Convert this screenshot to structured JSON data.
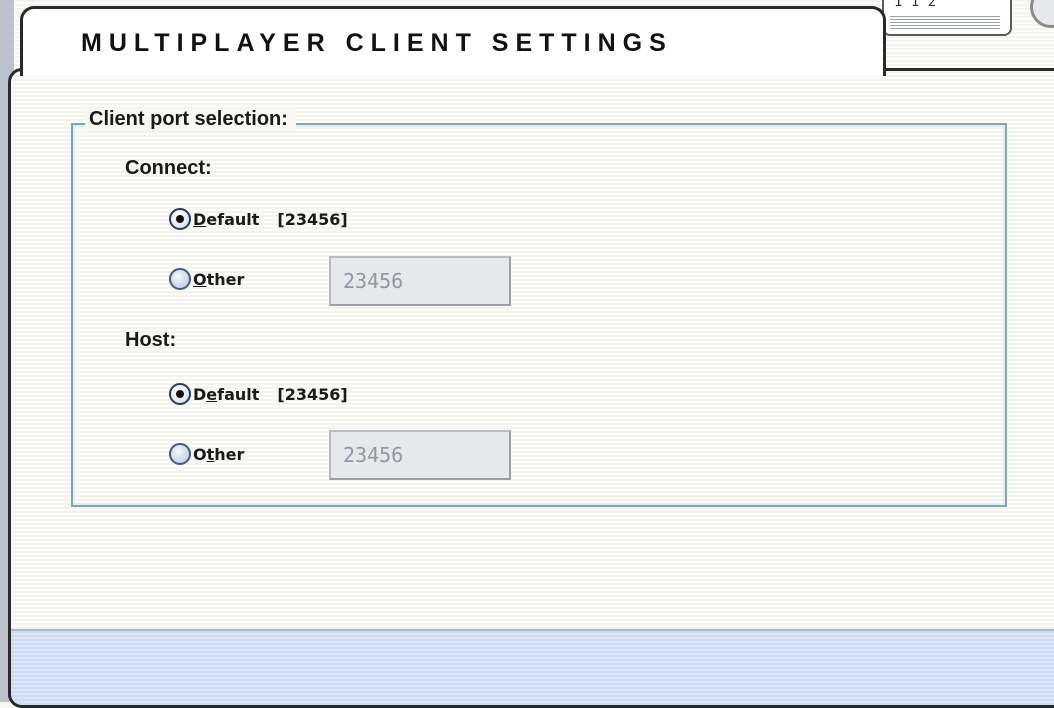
{
  "window": {
    "title": "MULTIPLAYER CLIENT SETTINGS",
    "corner_tab_fragment": "1 1 2"
  },
  "port_selection": {
    "legend": "Client port selection:",
    "connect": {
      "label": "Connect:",
      "default_option": {
        "label_pre": "",
        "label_mnemonic": "D",
        "label_post": "efault",
        "port_display": "[23456]",
        "checked": true
      },
      "other_option": {
        "label_pre": "",
        "label_mnemonic": "O",
        "label_post": "ther",
        "checked": false
      },
      "other_port_value": "23456"
    },
    "host": {
      "label": "Host:",
      "default_option": {
        "label_pre": "D",
        "label_mnemonic": "e",
        "label_post": "fault",
        "port_display": "[23456]",
        "checked": true
      },
      "other_option": {
        "label_pre": "O",
        "label_mnemonic": "t",
        "label_post": "her",
        "checked": false
      },
      "other_port_value": "23456"
    }
  },
  "colors": {
    "panel_border": "#2a2a2a",
    "groupbox_border": "#7fa8ad",
    "footer_bar": "#cddcf2",
    "disabled_input_text": "#8f98a6"
  }
}
